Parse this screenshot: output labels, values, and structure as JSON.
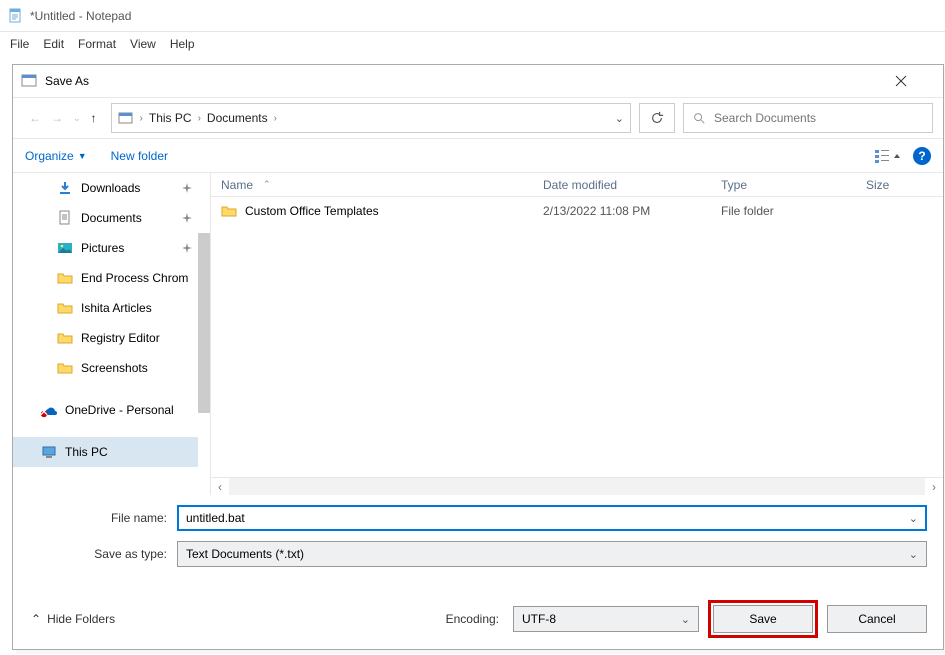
{
  "notepad": {
    "title": "*Untitled - Notepad",
    "menu": [
      "File",
      "Edit",
      "Format",
      "View",
      "Help"
    ]
  },
  "dialog": {
    "title": "Save As",
    "breadcrumb": {
      "root": "This PC",
      "path": [
        "Documents"
      ]
    },
    "search_placeholder": "Search Documents",
    "toolbar": {
      "organize": "Organize",
      "new_folder": "New folder"
    },
    "sidebar": [
      {
        "name": "Downloads",
        "icon": "download-icon",
        "pinned": true
      },
      {
        "name": "Documents",
        "icon": "document-icon",
        "pinned": true
      },
      {
        "name": "Pictures",
        "icon": "pictures-icon",
        "pinned": true
      },
      {
        "name": "End Process Chrom",
        "icon": "folder-icon"
      },
      {
        "name": "Ishita Articles",
        "icon": "folder-icon"
      },
      {
        "name": "Registry Editor",
        "icon": "folder-icon"
      },
      {
        "name": "Screenshots",
        "icon": "folder-icon"
      },
      {
        "name": "OneDrive - Personal",
        "icon": "onedrive-error-icon",
        "indent": true
      },
      {
        "name": "This PC",
        "icon": "thispc-icon",
        "indent": true,
        "selected": true
      }
    ],
    "columns": {
      "name": "Name",
      "date": "Date modified",
      "type": "Type",
      "size": "Size"
    },
    "rows": [
      {
        "name": "Custom Office Templates",
        "date": "2/13/2022 11:08 PM",
        "type": "File folder"
      }
    ],
    "fields": {
      "file_name_label": "File name:",
      "file_name_value": "untitled.bat",
      "save_as_type_label": "Save as type:",
      "save_as_type_value": "Text Documents (*.txt)"
    },
    "footer": {
      "hide_folders": "Hide Folders",
      "encoding_label": "Encoding:",
      "encoding_value": "UTF-8",
      "save": "Save",
      "cancel": "Cancel"
    }
  }
}
